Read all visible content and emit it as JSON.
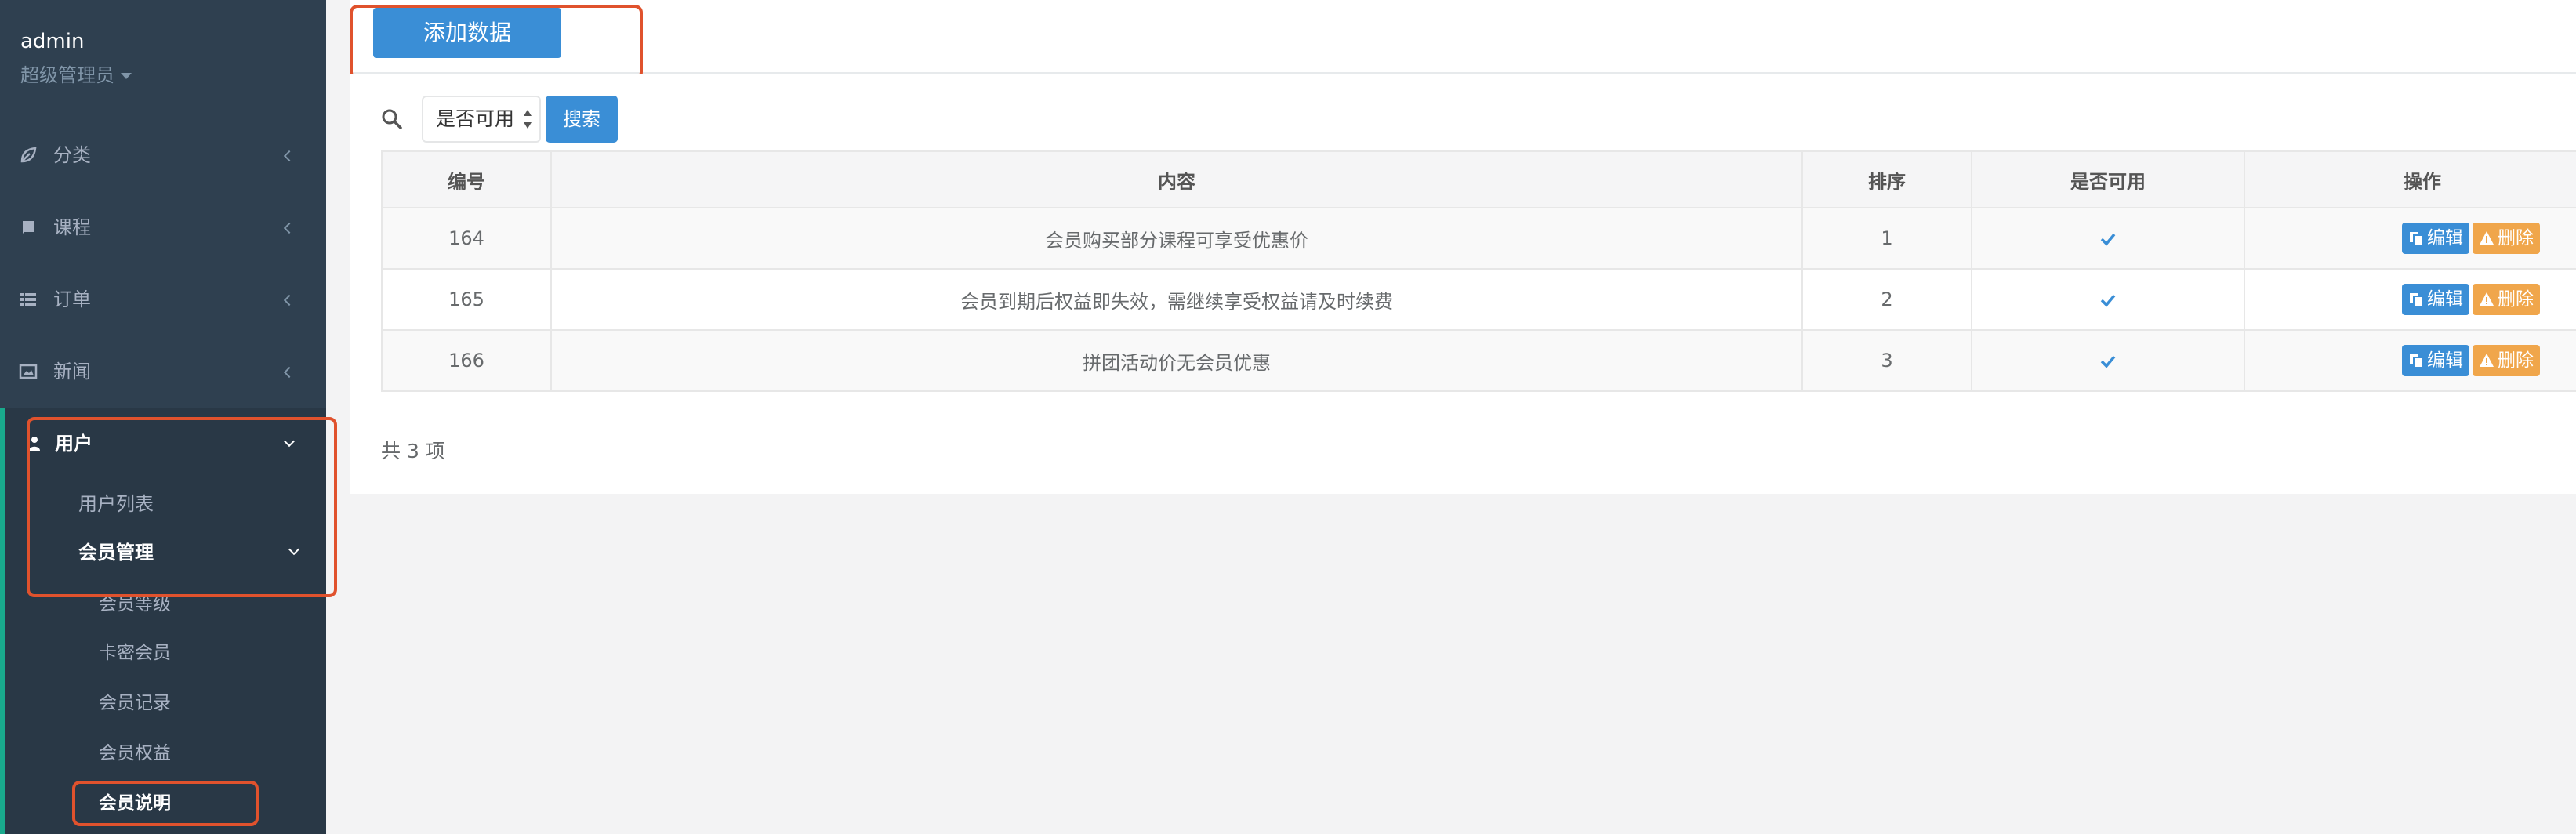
{
  "sidebar": {
    "username": "admin",
    "role": "超级管理员",
    "menu": [
      {
        "label": "分类",
        "icon": "leaf-icon"
      },
      {
        "label": "课程",
        "icon": "book-icon"
      },
      {
        "label": "订单",
        "icon": "list-icon"
      },
      {
        "label": "新闻",
        "icon": "image-icon"
      },
      {
        "label": "用户",
        "icon": "user-icon"
      }
    ],
    "user_sub": {
      "user_list": "用户列表",
      "member_mgmt": "会员管理"
    },
    "member_sub": [
      "会员等级",
      "卡密会员",
      "会员记录",
      "会员权益",
      "会员说明"
    ]
  },
  "toolbar": {
    "add_label": "添加数据"
  },
  "search": {
    "select_value": "是否可用",
    "button_label": "搜索"
  },
  "table": {
    "headers": [
      "编号",
      "内容",
      "排序",
      "是否可用",
      "操作"
    ],
    "rows": [
      {
        "id": "164",
        "content": "会员购买部分课程可享受优惠价",
        "sort": "1"
      },
      {
        "id": "165",
        "content": "会员到期后权益即失效，需继续享受权益请及时续费",
        "sort": "2"
      },
      {
        "id": "166",
        "content": "拼团活动价无会员优惠",
        "sort": "3"
      }
    ],
    "edit_label": "编辑",
    "delete_label": "删除"
  },
  "footer": {
    "total": "共 3 项"
  },
  "colors": {
    "sidebar": "#2f4050",
    "primary": "#3a8ed6",
    "warning": "#f0a64b",
    "highlight": "#e0522d"
  }
}
